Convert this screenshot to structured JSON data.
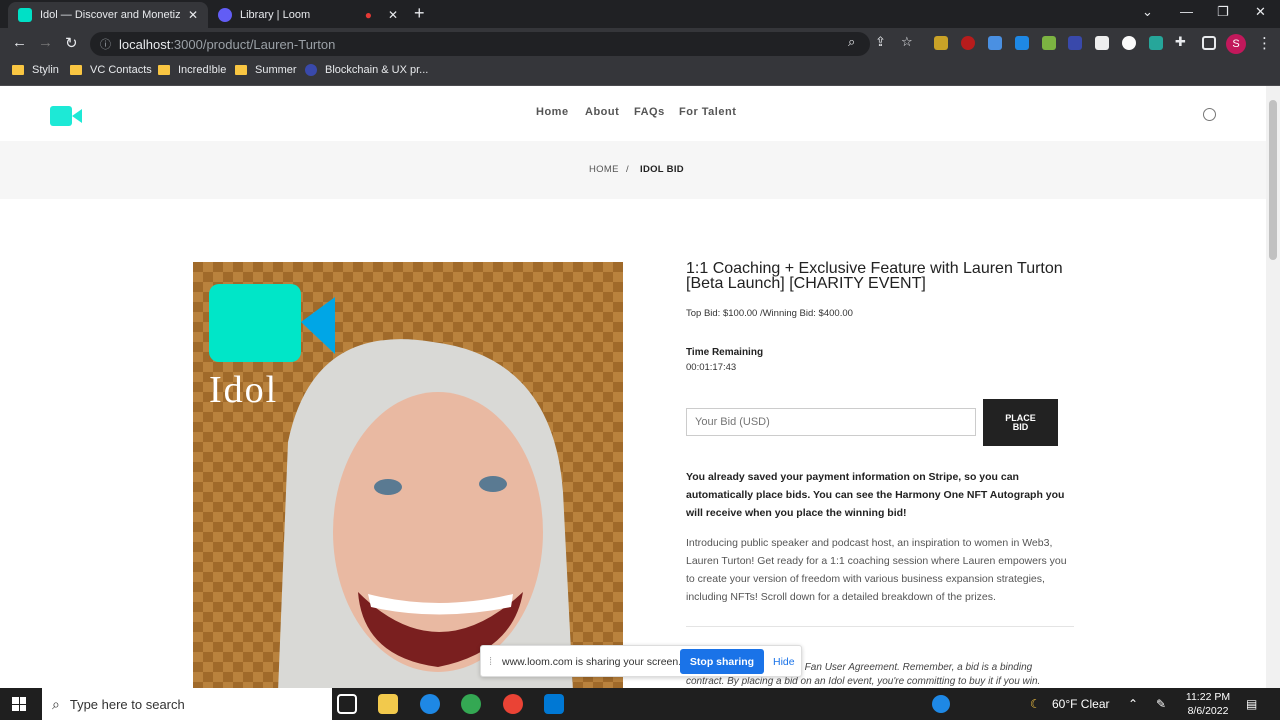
{
  "browser": {
    "tabs": [
      {
        "title": "Idol — Discover and Monetize Fa",
        "active": true,
        "favicon_color": "#00e0c6"
      },
      {
        "title": "Library | Loom",
        "active": false,
        "favicon_color": "#625df5"
      }
    ],
    "url_host": "localhost",
    "url_path": ":3000/product/Lauren-Turton",
    "profile_initial": "S",
    "bookmarks": [
      "Stylin",
      "VC Contacts",
      "Incred!ble",
      "Summer",
      "Blockchain & UX pr..."
    ]
  },
  "site": {
    "brand_color": "#1de9d6",
    "nav": [
      "Home",
      "About",
      "FAQs",
      "For Talent"
    ],
    "breadcrumb": {
      "home": "HOME",
      "separator": "/",
      "current": "IDOL BID"
    },
    "hero_logo_text": "Idol"
  },
  "product": {
    "title": "1:1 Coaching + Exclusive Feature with Lauren Turton [Beta Launch] [CHARITY EVENT]",
    "bid_info": "Top Bid: $100.00 /Winning Bid: $400.00",
    "time_remaining_label": "Time Remaining",
    "time_remaining_value": "00:01:17:43",
    "bid_placeholder": "Your Bid (USD)",
    "place_bid_label": "PLACE BID",
    "notice": "You already saved your payment information on Stripe, so you can automatically place bids. You can see the Harmony One NFT Autograph you will receive when you place the winning bid!",
    "intro": "Introducing public speaker and podcast host, an inspiration to women in Web3, Lauren Turton! Get ready for a 1:1 coaching session where Lauren empowers you to create your version of freedom with various business expansion strategies, including NFTs! Scroll down for a detailed breakdown of the prizes.",
    "agreement_line1": "the Fan User Agreement. Remember, a bid is a binding",
    "agreement_line2": "contract. By placing a bid on an Idol event, you're committing to buy it if you win."
  },
  "loom": {
    "message": "www.loom.com is sharing your screen.",
    "stop_label": "Stop sharing",
    "hide_label": "Hide"
  },
  "taskbar": {
    "search_placeholder": "Type here to search",
    "weather": "60°F  Clear",
    "time": "11:22 PM",
    "date": "8/6/2022"
  }
}
